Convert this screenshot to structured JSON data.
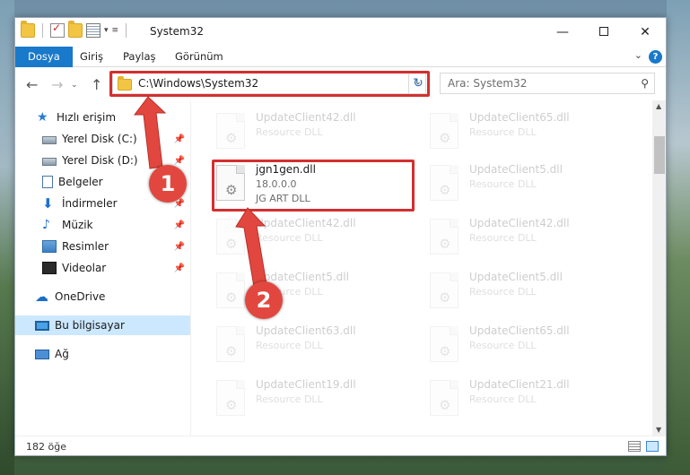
{
  "window": {
    "title": "System32",
    "controls": {
      "minimize": "—",
      "maximize": "",
      "close": "✕"
    }
  },
  "ribbon": {
    "tabs": [
      "Dosya",
      "Giriş",
      "Paylaş",
      "Görünüm"
    ]
  },
  "address": {
    "path": "C:\\Windows\\System32",
    "search_placeholder": "Ara: System32"
  },
  "sidebar": {
    "items": [
      {
        "label": "Hızlı erişim",
        "icon": "star-icon",
        "pinned": false
      },
      {
        "label": "Yerel Disk (C:)",
        "icon": "disk-icon",
        "pinned": true
      },
      {
        "label": "Yerel Disk (D:)",
        "icon": "disk-icon",
        "pinned": true
      },
      {
        "label": "Belgeler",
        "icon": "documents-icon",
        "pinned": true
      },
      {
        "label": "İndirmeler",
        "icon": "download-icon",
        "pinned": true
      },
      {
        "label": "Müzik",
        "icon": "music-icon",
        "pinned": true
      },
      {
        "label": "Resimler",
        "icon": "pictures-icon",
        "pinned": true
      },
      {
        "label": "Videolar",
        "icon": "videos-icon",
        "pinned": true
      },
      {
        "label": "OneDrive",
        "icon": "onedrive-icon",
        "pinned": false
      },
      {
        "label": "Bu bilgisayar",
        "icon": "this-pc-icon",
        "pinned": false,
        "selected": true
      },
      {
        "label": "Ağ",
        "icon": "network-icon",
        "pinned": false
      }
    ]
  },
  "files": [
    {
      "name": "UpdateClient42.dll",
      "desc": "Resource DLL",
      "faded": true
    },
    {
      "name": "UpdateClient65.dll",
      "desc": "Resource DLL",
      "faded": true
    },
    {
      "name": "jgn1gen.dll",
      "version": "18.0.0.0",
      "desc": "JG ART DLL",
      "faded": false
    },
    {
      "name": "UpdateClient5.dll",
      "desc": "Resource DLL",
      "faded": true
    },
    {
      "name": "UpdateClient42.dll",
      "desc": "Resource DLL",
      "faded": true
    },
    {
      "name": "UpdateClient42.dll",
      "desc": "Resource DLL",
      "faded": true
    },
    {
      "name": "UpdateClient5.dll",
      "desc": "Resource DLL",
      "faded": true
    },
    {
      "name": "UpdateClient5.dll",
      "desc": "Resource DLL",
      "faded": true
    },
    {
      "name": "UpdateClient63.dll",
      "desc": "Resource DLL",
      "faded": true
    },
    {
      "name": "UpdateClient65.dll",
      "desc": "Resource DLL",
      "faded": true
    },
    {
      "name": "UpdateClient19.dll",
      "desc": "Resource DLL",
      "faded": true
    },
    {
      "name": "UpdateClient21.dll",
      "desc": "Resource DLL",
      "faded": true
    }
  ],
  "status": {
    "count": "182 öğe"
  },
  "annotations": {
    "badge1": "1",
    "badge2": "2",
    "color": "#e2473f"
  }
}
